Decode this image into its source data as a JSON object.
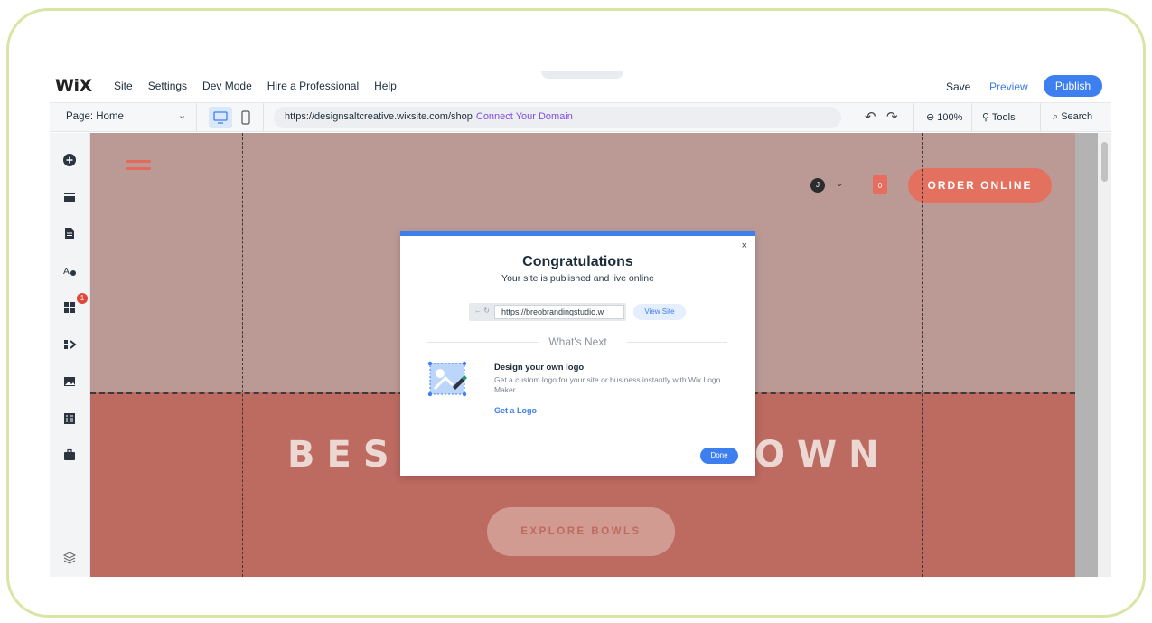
{
  "topbar": {
    "logo": "WiX",
    "menu": [
      "Site",
      "Settings",
      "Dev Mode",
      "Hire a Professional",
      "Help"
    ],
    "handle": "^",
    "save": "Save",
    "preview": "Preview",
    "publish": "Publish"
  },
  "toolbar": {
    "page_label": "Page: Home",
    "page_chevron": "⌄",
    "url": "https://designsaltcreative.wixsite.com/shop",
    "connect_domain": "Connect Your Domain",
    "undo": "↶",
    "redo": "↷",
    "zoom": "⊖ 100%",
    "tools": "Tools",
    "search": "Search"
  },
  "left_tools": {
    "badge_count": "1",
    "icons": [
      "add-icon",
      "sections-icon",
      "pages-icon",
      "design-icon",
      "apps-icon",
      "business-icon",
      "media-icon",
      "cms-icon",
      "portfolio-icon",
      "layers-icon"
    ]
  },
  "site": {
    "avatar_letter": "J",
    "avatar_chevron": "⌄",
    "cart_count": "0",
    "order_button": "ORDER ONLINE",
    "hero_left": "BEST",
    "hero_right": "OWN",
    "explore_button": "EXPLORE BOWLS"
  },
  "modal": {
    "close": "×",
    "title": "Congratulations",
    "subtitle": "Your site is published and live online",
    "nav_arrows": "← ↻",
    "url": "https://breobrandingstudio.w",
    "view_site": "View Site",
    "whats_next": "What's Next",
    "logo_heading": "Design your own logo",
    "logo_desc": "Get a custom logo for your site or business instantly with Wix Logo Maker.",
    "get_logo": "Get a Logo",
    "done": "Done"
  },
  "colors": {
    "accent": "#3e7ff0",
    "frame_border": "#d7e6a4",
    "site_top": "#bb9a96",
    "site_bottom": "#bd6a60",
    "order_button": "#e4705f"
  }
}
